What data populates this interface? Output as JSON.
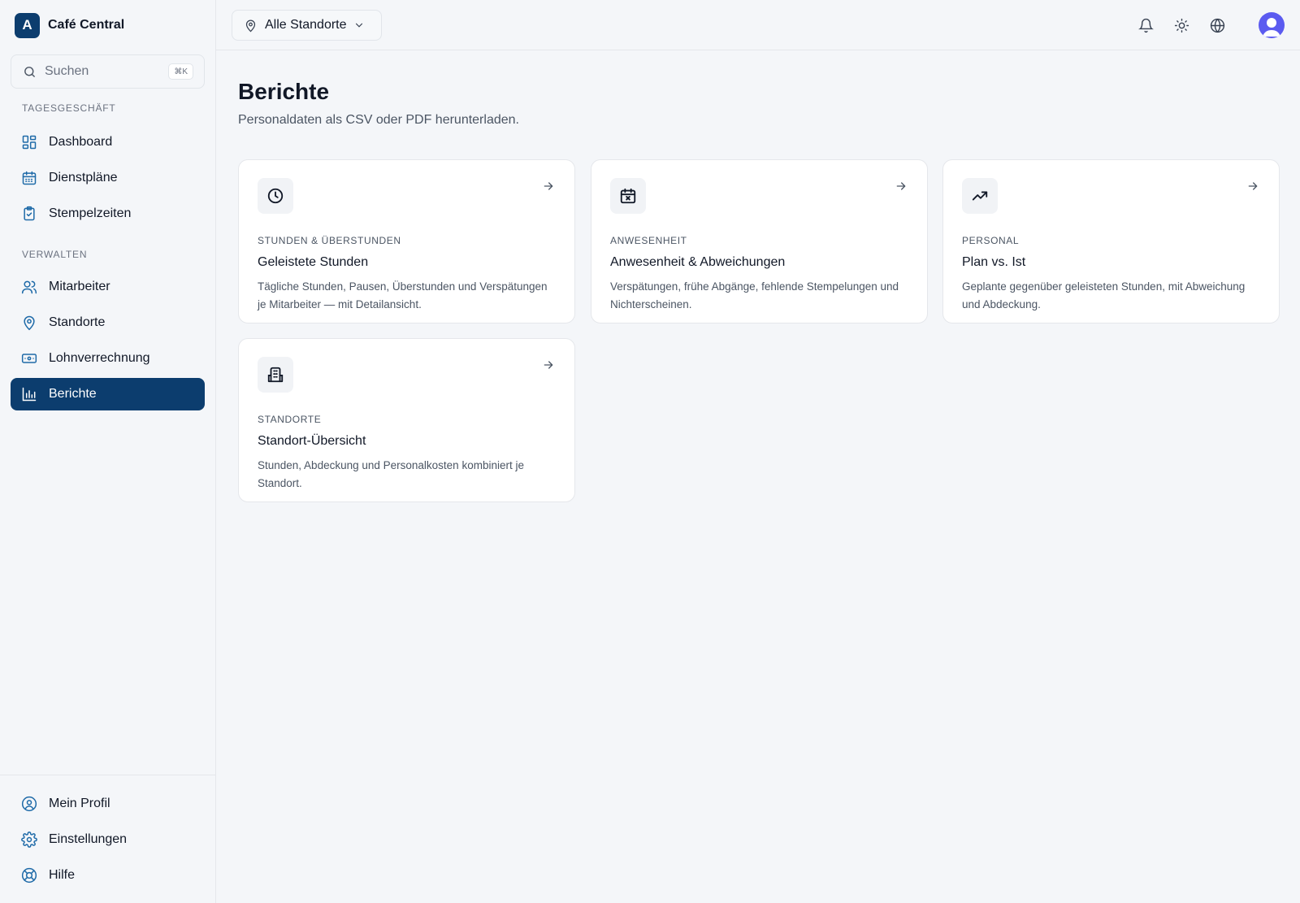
{
  "brand": {
    "logo_letter": "A",
    "name": "Café Central"
  },
  "search": {
    "label": "Suchen",
    "shortcut": "⌘K"
  },
  "sidebar": {
    "sections": [
      {
        "title": "TAGESGESCHÄFT"
      },
      {
        "title": "VERWALTEN"
      }
    ],
    "items": [
      {
        "label": "Dashboard",
        "icon": "dashboard-icon"
      },
      {
        "label": "Dienstpläne",
        "icon": "calendar-icon"
      },
      {
        "label": "Stempelzeiten",
        "icon": "clipboard-check-icon"
      },
      {
        "label": "Mitarbeiter",
        "icon": "users-icon"
      },
      {
        "label": "Standorte",
        "icon": "map-pin-icon"
      },
      {
        "label": "Lohnverrechnung",
        "icon": "banknote-icon"
      },
      {
        "label": "Berichte",
        "icon": "bar-chart-icon",
        "active": true
      }
    ],
    "footer_items": [
      {
        "label": "Mein Profil",
        "icon": "user-circle-icon"
      },
      {
        "label": "Einstellungen",
        "icon": "gear-icon"
      },
      {
        "label": "Hilfe",
        "icon": "lifebuoy-icon"
      }
    ]
  },
  "topbar": {
    "location_select": "Alle Standorte",
    "icons": [
      "bell-icon",
      "sun-icon",
      "globe-icon",
      "avatar"
    ]
  },
  "page": {
    "title": "Berichte",
    "subtitle": "Personaldaten als CSV oder PDF herunterladen."
  },
  "cards": [
    {
      "eyebrow": "STUNDEN & ÜBERSTUNDEN",
      "title": "Geleistete Stunden",
      "description": "Tägliche Stunden, Pausen, Überstunden und Verspätungen je Mitarbeiter — mit Detailansicht.",
      "icon": "clock-icon"
    },
    {
      "eyebrow": "ANWESENHEIT",
      "title": "Anwesenheit & Abweichungen",
      "description": "Verspätungen, frühe Abgänge, fehlende Stempelungen und Nichterscheinen.",
      "icon": "calendar-x-icon"
    },
    {
      "eyebrow": "PERSONAL",
      "title": "Plan vs. Ist",
      "description": "Geplante gegenüber geleisteten Stunden, mit Abweichung und Abdeckung.",
      "icon": "trending-up-icon"
    },
    {
      "eyebrow": "STANDORTE",
      "title": "Standort-Übersicht",
      "description": "Stunden, Abdeckung und Personalkosten kombiniert je Standort.",
      "icon": "building-icon"
    }
  ],
  "colors": {
    "accent": "#0c3d6e",
    "nav_icon": "#1e6aa8",
    "background": "#f4f6f9",
    "avatar": "#5b5bf0"
  }
}
